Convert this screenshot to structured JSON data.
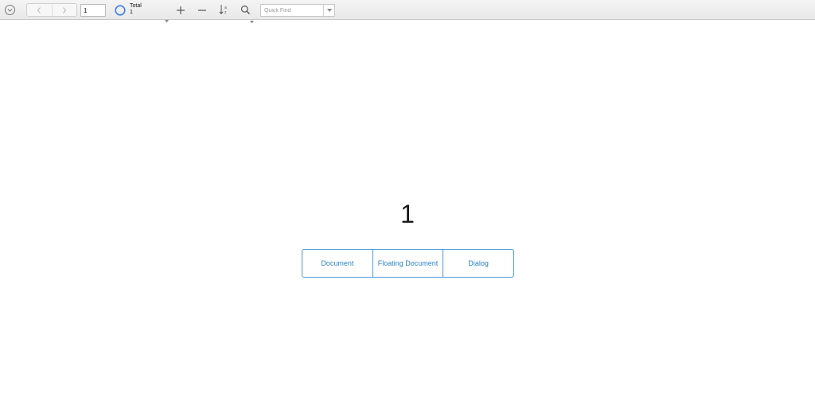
{
  "toolbar": {
    "record_number": "1",
    "total_label": "Total",
    "total_value": "1",
    "quick_find_placeholder": "Quick Find"
  },
  "content": {
    "record_value": "1",
    "buttons": [
      {
        "label": "Document"
      },
      {
        "label": "Floating Document"
      },
      {
        "label": "Dialog"
      }
    ]
  },
  "colors": {
    "accent": "#2b86c8",
    "border_accent": "#4a9ad9",
    "total_circle": "#3f7fe0"
  },
  "icons": {
    "menu": "chevron-down-circle-icon",
    "prev": "chevron-left-icon",
    "next": "chevron-right-icon",
    "total": "circle-icon",
    "add": "plus-icon",
    "delete": "minus-icon",
    "sort": "sort-az-icon",
    "find": "magnifier-icon"
  }
}
